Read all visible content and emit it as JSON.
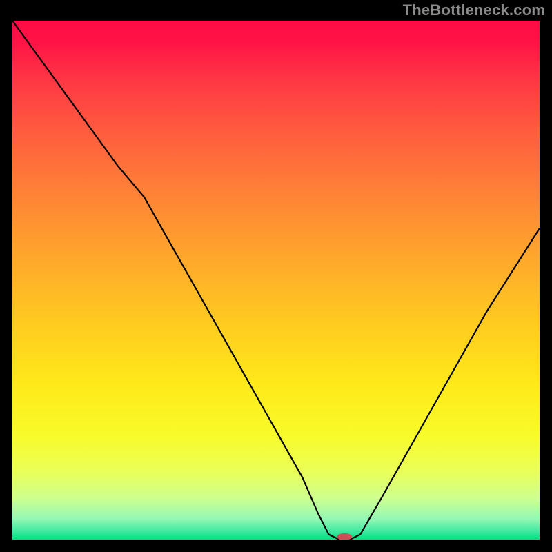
{
  "header": {
    "watermark": "TheBottleneck.com"
  },
  "chart_data": {
    "type": "line",
    "title": "",
    "xlabel": "",
    "ylabel": "",
    "xlim": [
      0,
      100
    ],
    "ylim": [
      0,
      100
    ],
    "grid": false,
    "legend": false,
    "x": [
      0,
      5,
      10,
      15,
      20,
      25,
      30,
      35,
      40,
      45,
      50,
      55,
      58,
      60,
      62,
      64,
      66,
      70,
      75,
      80,
      85,
      90,
      95,
      100
    ],
    "y": [
      100,
      93,
      86,
      79,
      72,
      66,
      57,
      48,
      39,
      30,
      21,
      12,
      5,
      1,
      0,
      0,
      1,
      8,
      17,
      26,
      35,
      44,
      52,
      60
    ],
    "marker": {
      "x": 63,
      "y": 0,
      "color": "#cf4d56",
      "rx": 11,
      "ry": 5
    },
    "background": {
      "type": "vertical_gradient",
      "stops": [
        {
          "offset": 0.0,
          "color": "#ff0b45"
        },
        {
          "offset": 0.04,
          "color": "#ff1346"
        },
        {
          "offset": 0.12,
          "color": "#ff3944"
        },
        {
          "offset": 0.22,
          "color": "#ff5e3e"
        },
        {
          "offset": 0.34,
          "color": "#ff8436"
        },
        {
          "offset": 0.46,
          "color": "#ffa82b"
        },
        {
          "offset": 0.58,
          "color": "#ffca20"
        },
        {
          "offset": 0.7,
          "color": "#ffe91a"
        },
        {
          "offset": 0.8,
          "color": "#f8fb2a"
        },
        {
          "offset": 0.87,
          "color": "#e9ff58"
        },
        {
          "offset": 0.92,
          "color": "#ceff8f"
        },
        {
          "offset": 0.96,
          "color": "#94f8b4"
        },
        {
          "offset": 0.985,
          "color": "#3be89f"
        },
        {
          "offset": 1.0,
          "color": "#00e07e"
        }
      ]
    }
  }
}
